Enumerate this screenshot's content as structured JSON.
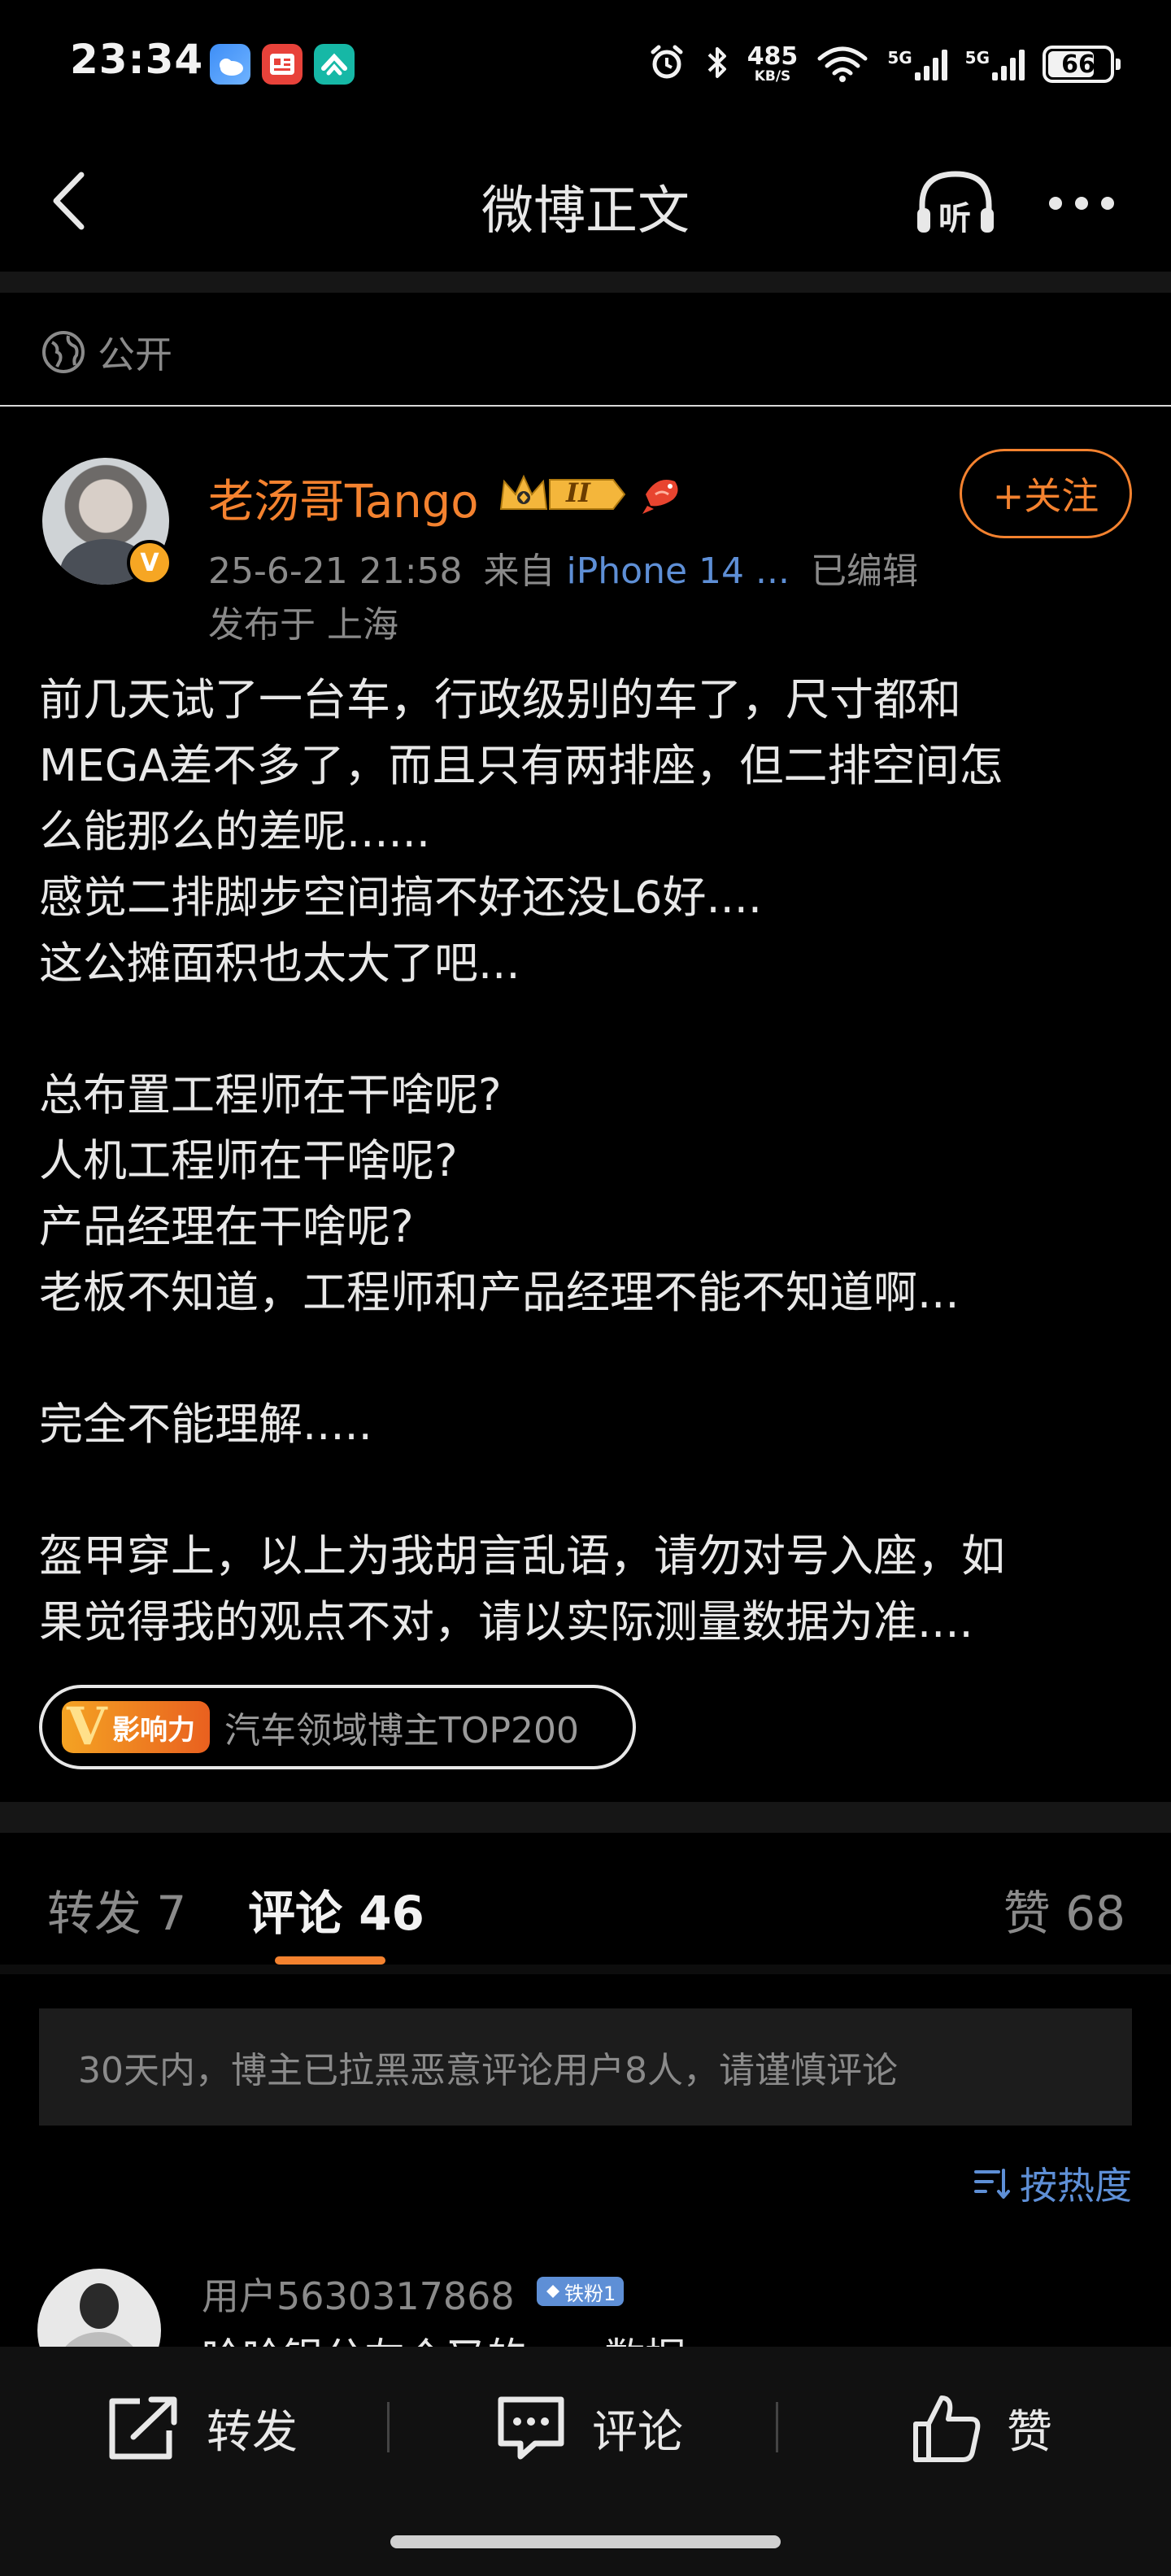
{
  "status_bar": {
    "time": "23:34",
    "net_speed_value": "485",
    "net_speed_unit": "KB/S",
    "signal_1_label": "5G",
    "signal_2_label": "5G",
    "battery": "66",
    "icons": [
      "weather-app-icon",
      "news-app-icon",
      "teal-app-icon",
      "alarm-icon",
      "bluetooth-icon",
      "wifi-icon",
      "signal-icon",
      "battery-icon"
    ]
  },
  "nav": {
    "title": "微博正文",
    "listen_label": "听"
  },
  "visibility": "公开",
  "post": {
    "author": "老汤哥Tango",
    "verify_mark": "V",
    "crown_level": "II",
    "follow_label": "+关注",
    "date": "25-6-21 21:58",
    "source_prefix": "来自",
    "source": "iPhone 14 ...",
    "edited": "已编辑",
    "location": "发布于 上海",
    "content": "前几天试了一台车，行政级别的车了，尺寸都和\nMEGA差不多了，而且只有两排座，但二排空间怎\n么能那么的差呢......\n感觉二排脚步空间搞不好还没L6好....\n这公摊面积也太大了吧...\n\n总布置工程师在干啥呢?\n人机工程师在干啥呢?\n产品经理在干啥呢?\n老板不知道，工程师和产品经理不能不知道啊...\n\n完全不能理解.....\n\n盔甲穿上，以上为我胡言乱语，请勿对号入座，如\n果觉得我的观点不对，请以实际测量数据为准....",
    "influence_badge": "影响力",
    "influence_text": "汽车领域博主TOP200"
  },
  "tabs": {
    "repost": "转发 7",
    "comment": "评论 46",
    "like": "赞 68"
  },
  "notice": "30天内，博主已拉黑恶意评论用户8人，请谨慎评论",
  "sort_label": "按热度",
  "comment": {
    "username": "用户5630317868",
    "fan_badge": "铁粉1",
    "text_partial": "哈哈铝分左个又的......数据"
  },
  "bottom_bar": {
    "repost": "转发",
    "comment": "评论",
    "like": "赞"
  },
  "colors": {
    "accent": "#f4822f",
    "link": "#5e8fd6",
    "background": "#000000"
  }
}
